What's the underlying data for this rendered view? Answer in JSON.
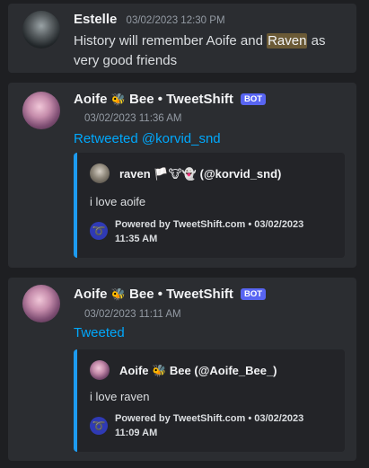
{
  "messages": [
    {
      "author": "Estelle",
      "timestamp": "03/02/2023 12:30 PM",
      "content_before": "History will remember Aoife and ",
      "content_highlight": "Raven",
      "content_after": " as very good friends"
    },
    {
      "author": "Aoife",
      "author_icon": "🐝",
      "author_suffix": "Bee • TweetShift",
      "badge": "BOT",
      "timestamp": "03/02/2023 11:36 AM",
      "link_text": "Retweeted @korvid_snd",
      "embed": {
        "author": "raven 🏳️🐮👻 (@korvid_snd)",
        "text": "i love aoife",
        "footer": "Powered by TweetShift.com • 03/02/2023 11:35 AM"
      }
    },
    {
      "author": "Aoife",
      "author_icon": "🐝",
      "author_suffix": "Bee • TweetShift",
      "badge": "BOT",
      "timestamp": "03/02/2023 11:11 AM",
      "link_text": "Tweeted",
      "embed": {
        "author": "Aoife 🐝 Bee (@Aoife_Bee_)",
        "text": "i love raven",
        "footer": "Powered by TweetShift.com • 03/02/2023 11:09 AM"
      }
    }
  ],
  "icons": {
    "tweetshift": "tweetshift-bird-icon"
  },
  "colors": {
    "link": "#00a8fc",
    "bot_badge": "#5865f2",
    "embed_border": "#1d9bf0",
    "highlight": "#6b5a36"
  }
}
